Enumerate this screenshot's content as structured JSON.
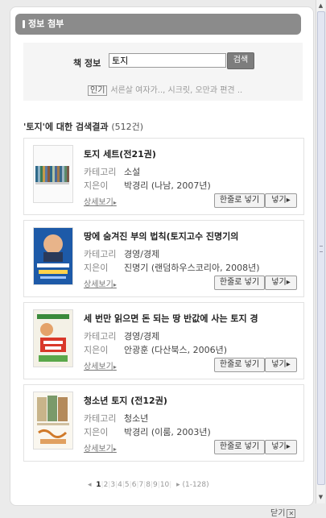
{
  "header": {
    "title": "정보 첨부"
  },
  "search": {
    "label": "책 정보",
    "value": "토지",
    "button": "검색",
    "popular_tag": "인기",
    "popular_text": "서른살 여자가.., 시크릿, 오만과 편견 .."
  },
  "results": {
    "query_label": "'토지'에 대한 검색결과",
    "count": "(512건)",
    "items": [
      {
        "title": "토지 세트(전21권)",
        "category_key": "카테고리",
        "category": "소설",
        "author_key": "지은이",
        "author": "박경리 (나남, 2007년)",
        "detail": "상세보기",
        "add_line": "한줄로 넣기",
        "add": "넣기"
      },
      {
        "title": "땅에 숨겨진 부의 법칙(토지고수 진명기의",
        "category_key": "카테고리",
        "category": "경영/경제",
        "author_key": "지은이",
        "author": "진명기 (랜덤하우스코리아, 2008년)",
        "detail": "상세보기",
        "add_line": "한줄로 넣기",
        "add": "넣기"
      },
      {
        "title": "세 번만 읽으면 돈 되는 땅 반값에 사는 토지 경",
        "category_key": "카테고리",
        "category": "경영/경제",
        "author_key": "지은이",
        "author": "안광훈 (다산북스, 2006년)",
        "detail": "상세보기",
        "add_line": "한줄로 넣기",
        "add": "넣기"
      },
      {
        "title": "청소년 토지 (전12권)",
        "category_key": "카테고리",
        "category": "청소년",
        "author_key": "지은이",
        "author": "박경리 (이룸, 2003년)",
        "detail": "상세보기",
        "add_line": "한줄로 넣기",
        "add": "넣기"
      }
    ]
  },
  "pagination": {
    "pages": [
      "1",
      "2",
      "3",
      "4",
      "5",
      "6",
      "7",
      "8",
      "9",
      "10"
    ],
    "current": "1",
    "total": "(1-128)"
  },
  "footer": {
    "close": "닫기"
  }
}
